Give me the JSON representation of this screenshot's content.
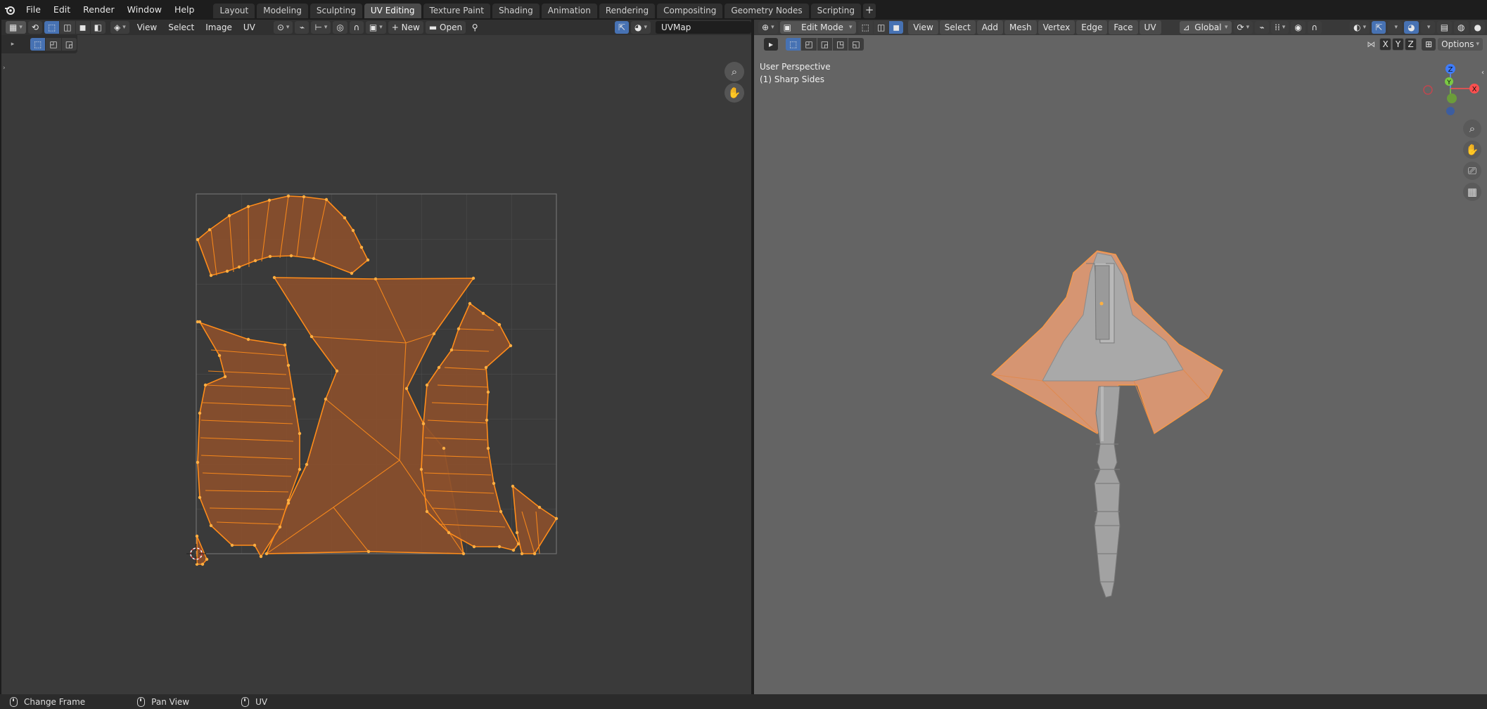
{
  "topbar": {
    "menus": [
      "File",
      "Edit",
      "Render",
      "Window",
      "Help"
    ],
    "workspaces": [
      "Layout",
      "Modeling",
      "Sculpting",
      "UV Editing",
      "Texture Paint",
      "Shading",
      "Animation",
      "Rendering",
      "Compositing",
      "Geometry Nodes",
      "Scripting"
    ],
    "active_workspace": "UV Editing",
    "add_label": "+"
  },
  "uv_editor": {
    "menus": [
      "View",
      "Select",
      "Image",
      "UV"
    ],
    "new_label": "New",
    "new_icon": "+",
    "open_label": "Open",
    "uv_map": "UVMap",
    "icons": [
      "editor-type-icon",
      "sync-icon",
      "vertex-select-icon",
      "edge-select-icon",
      "face-select-icon",
      "island-select-icon",
      "sticky-mode-icon",
      "pivot-icon",
      "snap-icon",
      "proportional-icon",
      "image-icon",
      "folder-icon",
      "pin-icon",
      "zoom-icon",
      "hand-icon",
      "cursor-icon"
    ],
    "colors": {
      "island_fill": "#8a4f2c",
      "island_edge": "#ff8c1a",
      "background": "#3a3a3a",
      "grid": "#565656"
    }
  },
  "viewport": {
    "mode": "Edit Mode",
    "menus": [
      "View",
      "Select",
      "Add",
      "Mesh",
      "Vertex",
      "Edge",
      "Face",
      "UV"
    ],
    "orientation": "Global",
    "perspective": "User Perspective",
    "object": "(1) Sharp Sides",
    "axis_buttons": [
      "X",
      "Y",
      "Z"
    ],
    "options_label": "Options",
    "gizmo": {
      "x": "X",
      "y": "Y",
      "z": "Z"
    },
    "icons": [
      "zoom-icon",
      "hand-icon",
      "camera-icon",
      "grid-icon"
    ],
    "colors": {
      "background": "#646464",
      "selection": "#e8a070",
      "mesh": "#a6a6a6"
    }
  },
  "statusbar": {
    "items": [
      {
        "label": "Change Frame"
      },
      {
        "label": "Pan View"
      },
      {
        "label": "UV"
      }
    ]
  }
}
